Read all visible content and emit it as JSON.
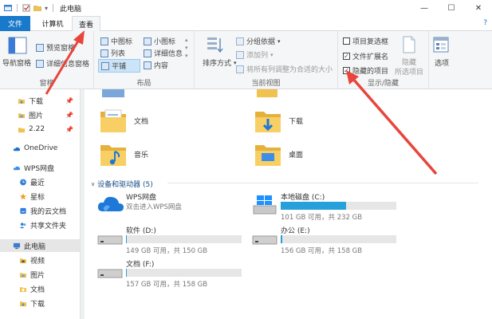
{
  "window": {
    "title": "此电脑",
    "controls": [
      "—",
      "☐",
      "✕"
    ]
  },
  "tabs": {
    "file": "文件",
    "computer": "计算机",
    "view": "查看",
    "help": "?"
  },
  "ribbon": {
    "groups": {
      "panes": {
        "label": "窗格",
        "nav_pane": "导航窗格",
        "preview_pane": "预览窗格",
        "details_pane": "详细信息窗格"
      },
      "layout": {
        "label": "布局",
        "items": [
          "中图标",
          "小图标",
          "列表",
          "详细信息",
          "平铺",
          "内容"
        ]
      },
      "current_view": {
        "label": "当前视图",
        "sort": "排序方式",
        "group_by": "分组依据",
        "add_column": "添加列",
        "fit_columns": "将所有列调整为合适的大小"
      },
      "show_hide": {
        "label": "显示/隐藏",
        "item_checkboxes": "项目复选框",
        "file_ext": "文件扩展名",
        "hidden_items": "隐藏的项目",
        "hide_btn": "隐藏",
        "hide_btn2": "所选项目"
      },
      "options": {
        "label": "选项"
      }
    }
  },
  "nav": {
    "items": [
      {
        "label": "下载",
        "pinned": true
      },
      {
        "label": "图片",
        "pinned": true
      },
      {
        "label": "2.22",
        "pinned": true
      },
      {
        "label": "OneDrive"
      },
      {
        "label": "WPS网盘"
      },
      {
        "label": "最近"
      },
      {
        "label": "星标"
      },
      {
        "label": "我的云文档"
      },
      {
        "label": "共享文件夹"
      },
      {
        "label": "此电脑"
      },
      {
        "label": "视频"
      },
      {
        "label": "图片"
      },
      {
        "label": "文档"
      },
      {
        "label": "下载"
      }
    ]
  },
  "content": {
    "folders": [
      "文档",
      "下载",
      "音乐",
      "桌面"
    ],
    "devices_section": "设备和驱动器 (5)",
    "drives": [
      {
        "name": "WPS网盘",
        "sub": "双击进入WPS网盘",
        "type": "cloud"
      },
      {
        "name": "本地磁盘 (C:)",
        "sub": "101 GB 可用，共 232 GB",
        "fill": 0.565,
        "type": "os"
      },
      {
        "name": "软件 (D:)",
        "sub": "149 GB 可用，共 150 GB",
        "fill": 0.007,
        "type": "hdd"
      },
      {
        "name": "办公 (E:)",
        "sub": "156 GB 可用，共 158 GB",
        "fill": 0.013,
        "type": "hdd"
      },
      {
        "name": "文档 (F:)",
        "sub": "157 GB 可用，共 158 GB",
        "fill": 0.006,
        "type": "hdd"
      }
    ]
  },
  "colors": {
    "accent": "#1979ca",
    "bar": "#26a0da",
    "folder": "#f0c24f",
    "arrow": "#e8453c"
  }
}
